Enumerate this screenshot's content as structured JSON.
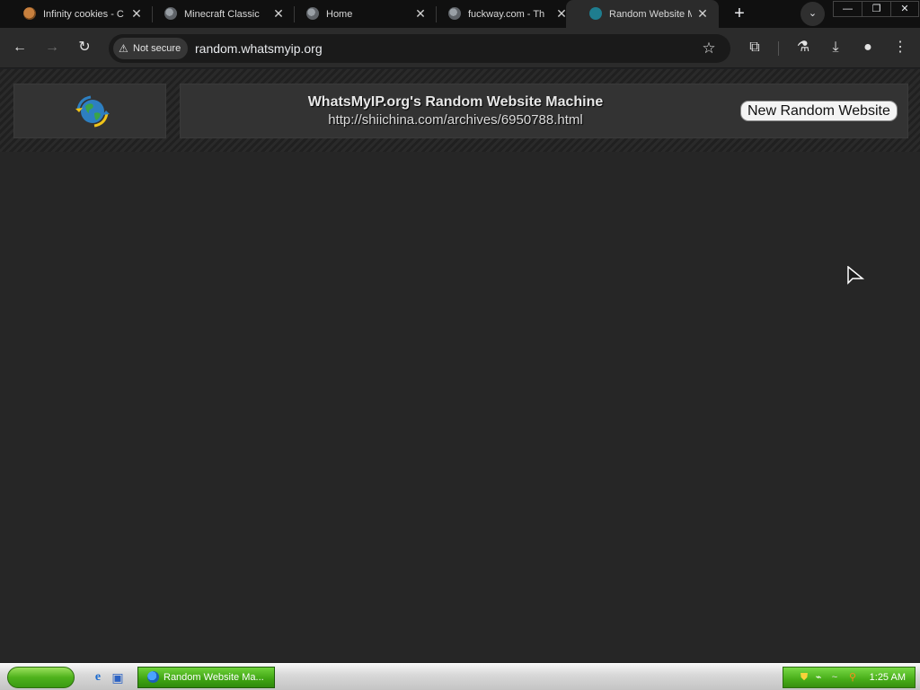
{
  "browser": {
    "tabs": [
      {
        "title": "Infinity cookies - C",
        "favicon": "cookie-icon",
        "active": false
      },
      {
        "title": "Minecraft Classic",
        "favicon": "globe-icon",
        "active": false
      },
      {
        "title": "Home",
        "favicon": "globe-icon",
        "active": false
      },
      {
        "title": "fuckway.com - Th",
        "favicon": "globe-icon",
        "active": false
      },
      {
        "title": "Random Website M",
        "favicon": "whatsmyip-icon",
        "active": true
      }
    ],
    "new_tab": "+",
    "tab_search": "⌄",
    "window_buttons": {
      "minimize": "—",
      "restore": "❐",
      "close": "✕"
    },
    "toolbar": {
      "back": "←",
      "forward": "→",
      "reload": "↻",
      "security_chip": "Not secure",
      "url": "random.whatsmyip.org",
      "bookmark": "☆",
      "extensions": "⧉",
      "labs": "⚗",
      "downloads": "⤓",
      "profile": "●",
      "menu": "⋮"
    }
  },
  "page": {
    "title": "WhatsMyIP.org's Random Website Machine",
    "current_url": "http://shiichina.com/archives/6950788.html",
    "button_label": "New Random Website",
    "background_color": "#262626"
  },
  "taskbar": {
    "task_label": "Random Website Ma...",
    "clock": "1:25 AM"
  }
}
